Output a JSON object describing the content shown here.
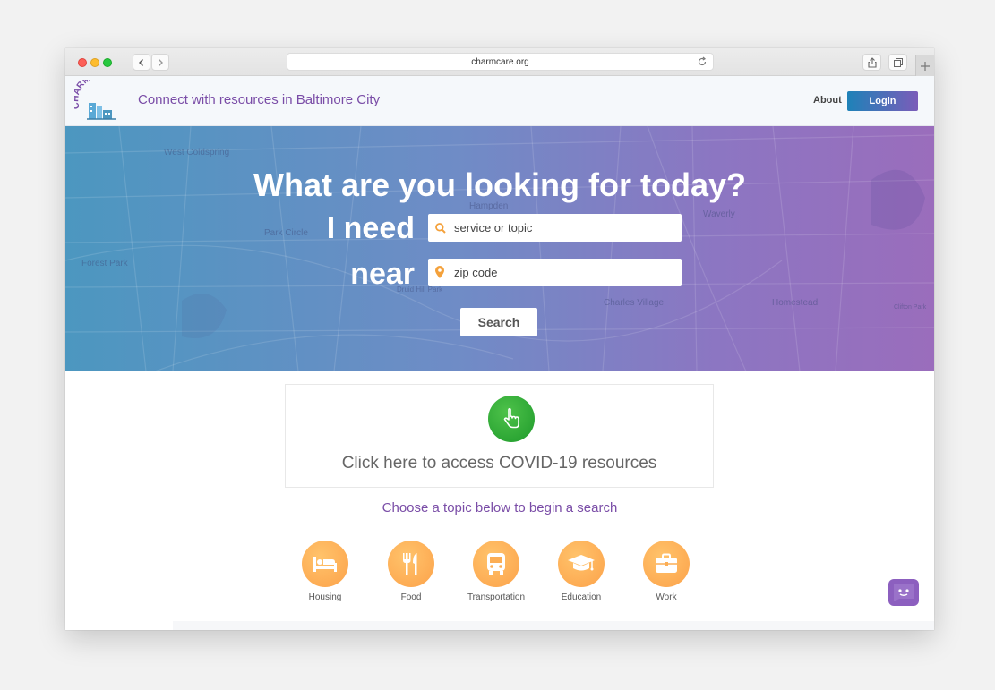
{
  "browser": {
    "url": "charmcare.org",
    "icons": {
      "back": "chevron-left-icon",
      "forward": "chevron-right-icon",
      "reload": "reload-icon",
      "share": "share-icon",
      "tabs": "tabs-icon",
      "new_tab": "plus-icon"
    }
  },
  "header": {
    "logo_text": "CHARMcare",
    "tagline": "Connect with resources in Baltimore City",
    "about_label": "About",
    "login_label": "Login",
    "colors": {
      "tagline": "#7a4da7",
      "login_start": "#1e82b8",
      "login_end": "#7b5cb9"
    }
  },
  "hero": {
    "title": "What are you looking for today?",
    "need_label": "I need",
    "need_placeholder": "service or topic",
    "near_label": "near",
    "near_placeholder": "zip code",
    "search_label": "Search",
    "map_labels": [
      "West Coldspring",
      "Hampden",
      "Park Circle",
      "Forest Park",
      "Druid Hill Park",
      "Waverly",
      "Charles Village",
      "Homestead",
      "Clifton Park"
    ],
    "colors": {
      "gradient_start": "#4c97c0",
      "gradient_end": "#9a6dbc"
    }
  },
  "covid": {
    "text": "Click here to access COVID-19 resources",
    "icon": "hand-pointer-icon",
    "color": "#2aa836"
  },
  "topics_intro": "Choose a topic below to begin a search",
  "topics": [
    {
      "label": "Housing",
      "icon": "bed-icon"
    },
    {
      "label": "Food",
      "icon": "utensils-icon"
    },
    {
      "label": "Transportation",
      "icon": "bus-icon"
    },
    {
      "label": "Education",
      "icon": "graduation-cap-icon"
    },
    {
      "label": "Work",
      "icon": "briefcase-icon"
    }
  ],
  "topic_color": "#fcae55",
  "chat": {
    "icon": "chat-bot-icon",
    "color": "#8c5fbf"
  }
}
